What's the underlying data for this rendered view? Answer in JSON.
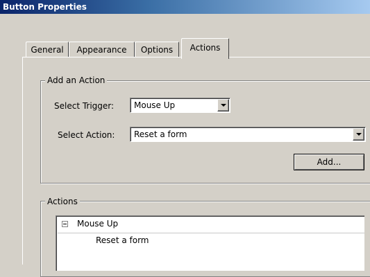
{
  "window": {
    "title": "Button Properties"
  },
  "tabs": [
    {
      "label": "General",
      "active": false
    },
    {
      "label": "Appearance",
      "active": false
    },
    {
      "label": "Options",
      "active": false
    },
    {
      "label": "Actions",
      "active": true
    }
  ],
  "add_action": {
    "group_title": "Add an Action",
    "trigger_label": "Select Trigger:",
    "trigger_value": "Mouse Up",
    "action_label": "Select Action:",
    "action_value": "Reset a form",
    "add_button": "Add..."
  },
  "actions": {
    "group_title": "Actions",
    "tree": [
      {
        "label": "Mouse Up",
        "expanded": true,
        "icon": "collapse-icon"
      },
      {
        "label": "Reset a form"
      }
    ]
  },
  "colors": {
    "titlebar_start": "#0a246a",
    "titlebar_end": "#a6caf0",
    "dialog_bg": "#d4d0c8"
  }
}
